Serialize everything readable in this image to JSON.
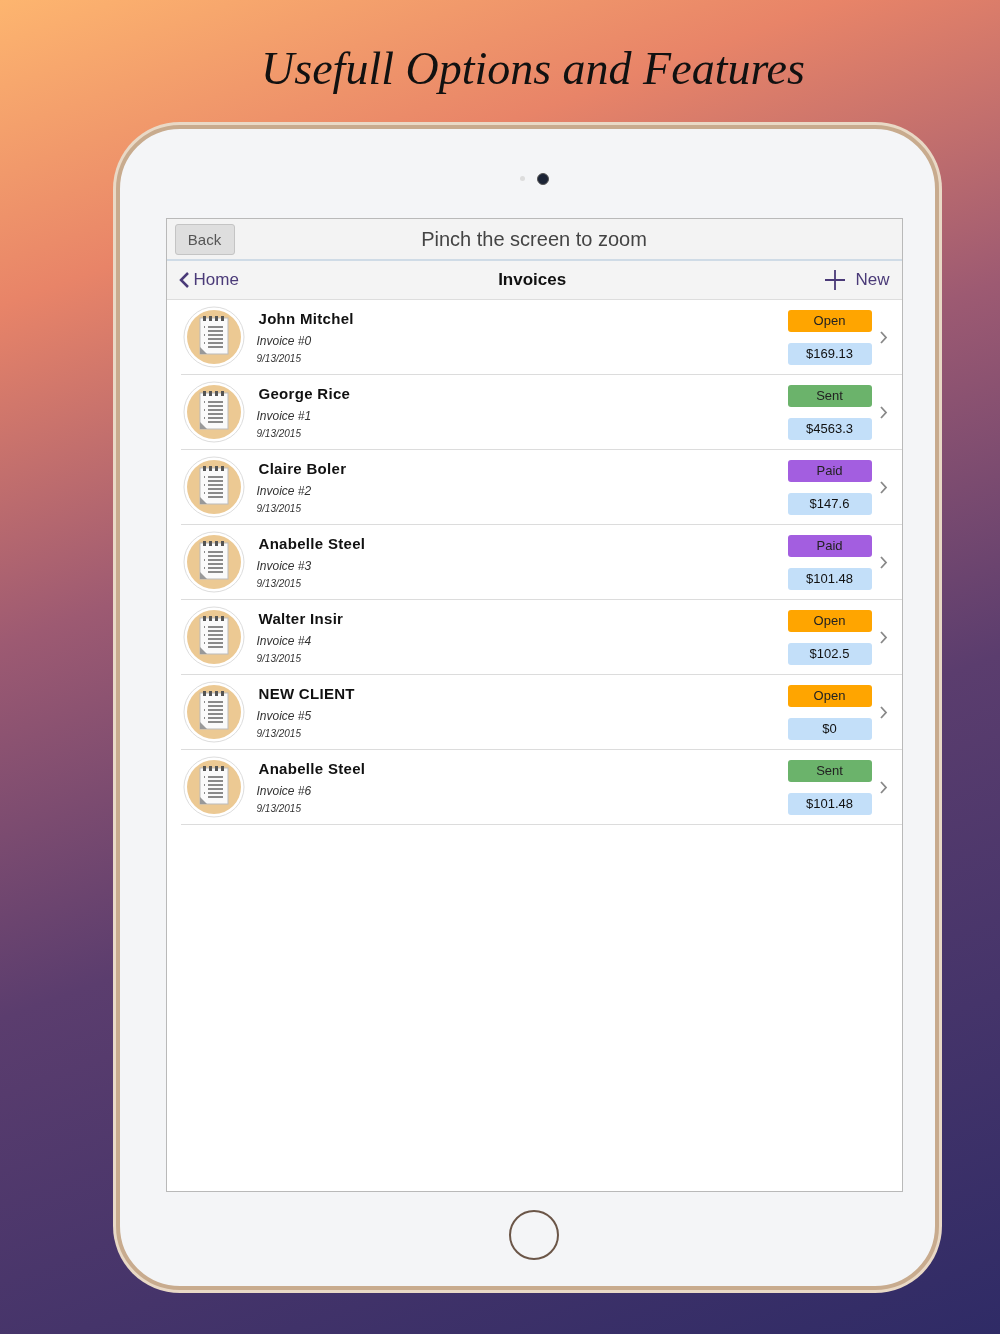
{
  "headline": "Usefull Options and Features",
  "top_bar": {
    "back_button": "Back",
    "hint": "Pinch the screen to zoom"
  },
  "nav_bar": {
    "back": "Home",
    "title": "Invoices",
    "new": "New"
  },
  "invoices": [
    {
      "client": "John Mitchel",
      "number": "Invoice #0",
      "date": "9/13/2015",
      "status": "Open",
      "color": "#ffa500",
      "amount": "$169.13"
    },
    {
      "client": "George Rice",
      "number": "Invoice #1",
      "date": "9/13/2015",
      "status": "Sent",
      "color": "#6bb36b",
      "amount": "$4563.3"
    },
    {
      "client": "Claire Boler",
      "number": "Invoice #2",
      "date": "9/13/2015",
      "status": "Paid",
      "color": "#a35ee0",
      "amount": "$147.6"
    },
    {
      "client": "Anabelle Steel",
      "number": "Invoice #3",
      "date": "9/13/2015",
      "status": "Paid",
      "color": "#a35ee0",
      "amount": "$101.48"
    },
    {
      "client": "Walter Insir",
      "number": "Invoice #4",
      "date": "9/13/2015",
      "status": "Open",
      "color": "#ffa500",
      "amount": "$102.5"
    },
    {
      "client": "NEW CLIENT",
      "number": "Invoice #5",
      "date": "9/13/2015",
      "status": "Open",
      "color": "#ffa500",
      "amount": "$0"
    },
    {
      "client": "Anabelle Steel",
      "number": "Invoice #6",
      "date": "9/13/2015",
      "status": "Sent",
      "color": "#6bb36b",
      "amount": "$101.48"
    }
  ]
}
